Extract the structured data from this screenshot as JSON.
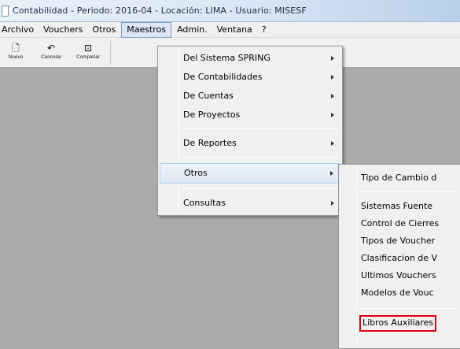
{
  "window": {
    "title": "Contabilidad  - Periodo: 2016-04 - Locación: LIMA - Usuario: MISESF"
  },
  "menubar": {
    "items": [
      {
        "label": "Archivo"
      },
      {
        "label": "Vouchers"
      },
      {
        "label": "Otros"
      },
      {
        "label": "Maestros",
        "active": true
      },
      {
        "label": "Admin."
      },
      {
        "label": "Ventana"
      },
      {
        "label": "?"
      }
    ]
  },
  "toolbar": {
    "buttons": [
      {
        "label": "Nuevo",
        "icon": "new-document-icon",
        "glyph": "🗋"
      },
      {
        "label": "Cancelar",
        "icon": "undo-icon",
        "glyph": "↶"
      },
      {
        "label": "Completar",
        "icon": "complete-icon",
        "glyph": "⊡"
      }
    ]
  },
  "maestros_menu": {
    "items": [
      {
        "label": "Del Sistema SPRING",
        "submenu": true
      },
      {
        "label": "De Contabilidades",
        "submenu": true
      },
      {
        "label": "De Cuentas",
        "submenu": true
      },
      {
        "label": "De Proyectos",
        "submenu": true
      },
      {
        "label": "De Reportes",
        "submenu": true
      },
      {
        "label": "Otros",
        "submenu": true,
        "highlighted": true
      },
      {
        "label": "Consultas",
        "submenu": true
      }
    ]
  },
  "otros_submenu": {
    "items": [
      {
        "label": "Tipo de Cambio d"
      },
      {
        "label": "Sistemas Fuente"
      },
      {
        "label": "Control de Cierres"
      },
      {
        "label": "Tipos de Voucher"
      },
      {
        "label": "Clasificacion de V"
      },
      {
        "label": "Ultimos Vouchers"
      },
      {
        "label": "Modelos de Vouc"
      },
      {
        "label": "Libros Auxiliares",
        "boxed": true
      }
    ]
  },
  "colors": {
    "highlight_box": "#e0000f",
    "workspace": "#ababab"
  }
}
